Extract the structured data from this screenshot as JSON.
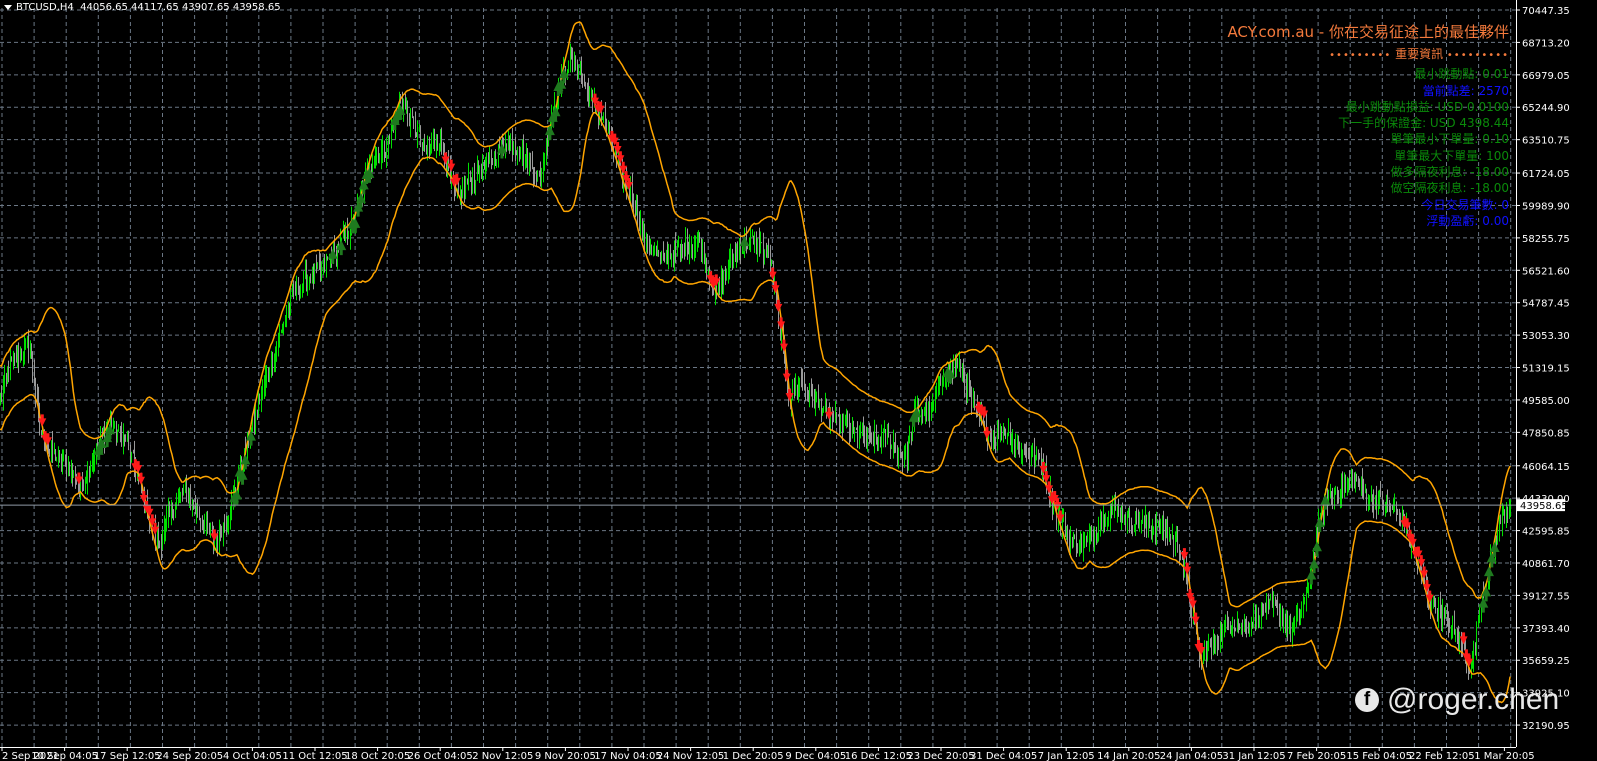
{
  "header": {
    "symbol": "BTCUSD,H4",
    "ohlc": "44056.65 44117.65 43907.65 43958.65"
  },
  "info_panel": {
    "title": "ACY.com.au - 你在交易征途上的最佳夥伴",
    "section": "重要資訊",
    "dots": "•••••••••",
    "rows": [
      {
        "text": "最小跳動點: 0.01",
        "color": "g"
      },
      {
        "text": "當前點差: 2570",
        "color": "b"
      },
      {
        "text": "最小跳動點損益: USD 0.0100",
        "color": "g"
      },
      {
        "text": "下一手的保證金: USD 4398.44",
        "color": "g"
      },
      {
        "text": "單筆最小下單量: 0.10",
        "color": "g"
      },
      {
        "text": "單筆最大下單量: 100",
        "color": "g"
      },
      {
        "text": "做多隔夜利息: -18.00",
        "color": "g"
      },
      {
        "text": "做空隔夜利息: -18.00",
        "color": "g"
      },
      {
        "text": "今日交易筆數: 0",
        "color": "b"
      },
      {
        "text": "浮動盈虧: 0.00",
        "color": "b"
      }
    ]
  },
  "watermark": {
    "icon": "facebook-icon",
    "text": "@roger.chen"
  },
  "colors": {
    "up": "#00e000",
    "down": "#9a9a9a",
    "band": "#ffa500",
    "grid": "#6b7785",
    "sell": "#ff1a1a",
    "buy": "#1f7a1f"
  },
  "chart_data": {
    "type": "ohlc",
    "symbol": "BTCUSD",
    "timeframe": "H4",
    "current_price": "43958.65",
    "ylim": [
      31000,
      70900
    ],
    "y_ticks": [
      "70447.35",
      "68713.20",
      "66979.05",
      "65244.90",
      "63510.75",
      "61724.05",
      "59989.90",
      "58255.75",
      "56521.60",
      "54787.45",
      "53053.30",
      "51319.15",
      "49585.00",
      "47850.85",
      "46064.15",
      "44330.00",
      "42595.85",
      "40861.70",
      "39127.55",
      "37393.40",
      "35659.25",
      "33925.10",
      "32190.95"
    ],
    "x_ticks": [
      "2 Sep 2021",
      "10 Sep 04:05",
      "17 Sep 12:05",
      "24 Sep 20:05",
      "4 Oct 04:05",
      "11 Oct 12:05",
      "18 Oct 20:05",
      "26 Oct 04:05",
      "2 Nov 12:05",
      "9 Nov 20:05",
      "17 Nov 04:05",
      "24 Nov 12:05",
      "1 Dec 20:05",
      "9 Dec 04:05",
      "16 Dec 12:05",
      "23 Dec 20:05",
      "31 Dec 04:05",
      "7 Jan 12:05",
      "14 Jan 20:05",
      "24 Jan 04:05",
      "31 Jan 12:05",
      "7 Feb 20:05",
      "15 Feb 04:05",
      "22 Feb 12:05",
      "1 Mar 20:05"
    ],
    "close_bar_index": [
      0,
      7,
      21,
      28,
      35,
      50,
      57,
      71,
      78,
      89,
      96,
      106,
      113,
      121,
      131,
      142,
      152,
      163,
      174,
      184,
      195,
      206,
      216,
      227,
      238,
      248,
      255,
      262,
      273,
      284,
      291,
      301,
      312,
      323,
      333,
      348,
      358,
      369,
      383,
      390,
      397,
      404,
      411,
      418,
      429,
      440,
      447,
      457,
      468,
      482,
      496,
      507,
      518,
      528,
      539,
      546,
      553,
      560,
      567,
      578,
      589,
      603,
      617,
      631,
      642,
      649,
      660,
      670,
      681,
      691,
      702,
      713,
      723,
      738,
      748,
      759,
      770,
      780,
      791,
      801,
      816,
      826,
      837,
      844,
      851,
      862,
      872,
      883,
      894,
      904,
      915,
      926,
      933,
      940,
      950,
      961,
      972,
      982,
      993,
      1004,
      1014,
      1025,
      1035,
      1043,
      1050,
      1057,
      1064,
      1071
    ],
    "close": [
      49582,
      51454,
      52524,
      47977,
      46907,
      45837,
      44767,
      47442,
      48244,
      47442,
      45837,
      43162,
      41824,
      43697,
      44767,
      43162,
      41824,
      43697,
      46907,
      49582,
      52257,
      54932,
      56002,
      56537,
      57607,
      58677,
      60282,
      62422,
      62957,
      65632,
      64562,
      62957,
      63492,
      60282,
      61352,
      62422,
      63492,
      62957,
      61352,
      64562,
      66702,
      67772,
      67237,
      65632,
      64562,
      61619,
      60817,
      58142,
      57072,
      57607,
      58142,
      55199,
      57072,
      58142,
      57874,
      57072,
      53327,
      49582,
      50652,
      49582,
      48512,
      47977,
      47442,
      47442,
      46372,
      49047,
      49047,
      51187,
      51187,
      49047,
      47442,
      47977,
      46907,
      46372,
      43697,
      42092,
      41824,
      43162,
      43697,
      43162,
      42894,
      42627,
      41557,
      38882,
      35672,
      36742,
      37812,
      37277,
      38347,
      38614,
      37277,
      38882,
      42092,
      44232,
      44767,
      45302,
      44232,
      44232,
      43429,
      41022,
      38882,
      37812,
      36742,
      35137,
      38882,
      41022,
      43162,
      44232
    ]
  }
}
